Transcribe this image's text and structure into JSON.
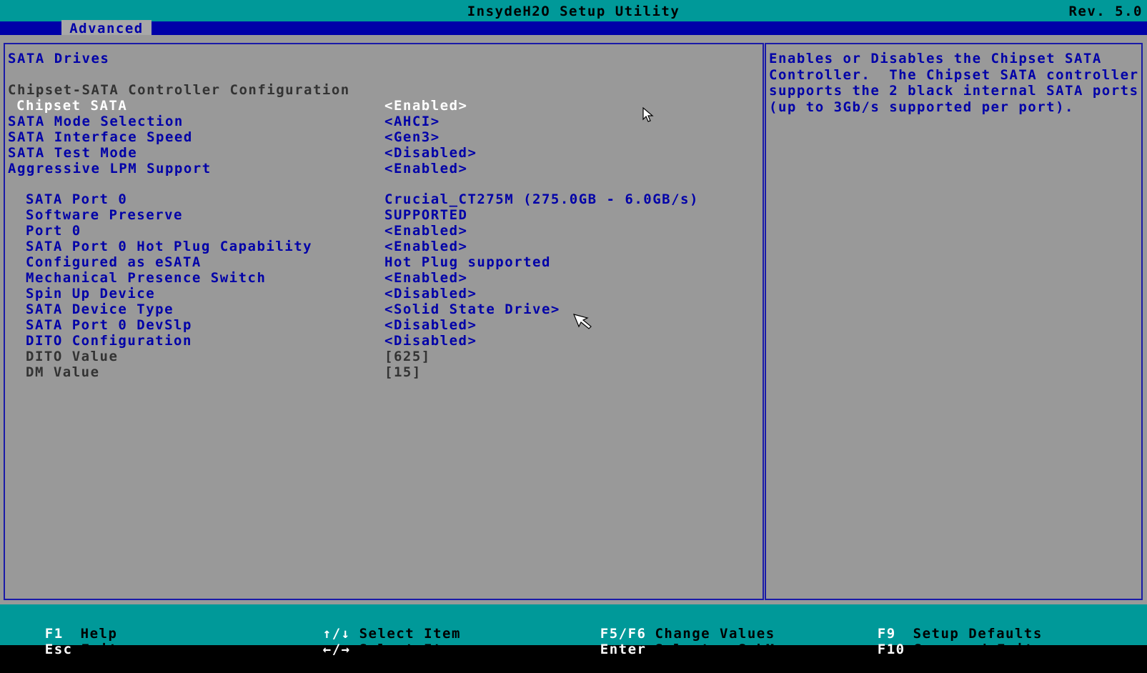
{
  "title": "InsydeH2O Setup Utility",
  "revision": "Rev. 5.0",
  "active_tab": "Advanced",
  "section_title": "SATA Drives",
  "subsection_title": "Chipset-SATA Controller Configuration",
  "settings": [
    {
      "label": "Chipset SATA",
      "value": "<Enabled>"
    },
    {
      "label": "SATA Mode Selection",
      "value": "<AHCI>"
    },
    {
      "label": "SATA Interface Speed",
      "value": "<Gen3>"
    },
    {
      "label": "SATA Test Mode",
      "value": "<Disabled>"
    },
    {
      "label": "Aggressive LPM Support",
      "value": "<Enabled>"
    }
  ],
  "port_settings": [
    {
      "label": "SATA Port 0",
      "value": "Crucial_CT275M (275.0GB - 6.0GB/s)"
    },
    {
      "label": "Software Preserve",
      "value": "SUPPORTED"
    },
    {
      "label": "Port 0",
      "value": "<Enabled>"
    },
    {
      "label": "SATA Port 0 Hot Plug Capability",
      "value": "<Enabled>"
    },
    {
      "label": "Configured as eSATA",
      "value": "Hot Plug supported"
    },
    {
      "label": "Mechanical Presence Switch",
      "value": "<Enabled>"
    },
    {
      "label": "Spin Up Device",
      "value": "<Disabled>"
    },
    {
      "label": "SATA Device Type",
      "value": "<Solid State Drive>"
    },
    {
      "label": "SATA Port 0 DevSlp",
      "value": "<Disabled>"
    },
    {
      "label": "DITO Configuration",
      "value": "<Disabled>"
    },
    {
      "label": "DITO Value",
      "value": "[625]"
    },
    {
      "label": "DM Value",
      "value": "[15]"
    }
  ],
  "help_text": "Enables or Disables the Chipset SATA\nController.  The Chipset SATA controller\nsupports the 2 black internal SATA ports\n(up to 3Gb/s supported per port).",
  "status": {
    "f1_key": "F1",
    "f1_label": "Help",
    "esc_key": "Esc",
    "esc_label": "Exit",
    "updown_key": "↑/↓",
    "updown_label": "Select Item",
    "leftright_key": "←/→",
    "leftright_label": "Select Item",
    "f5f6_key": "F5/F6",
    "f5f6_label": "Change Values",
    "enter_key": "Enter",
    "enter_label": "Select ▶ SubMenu",
    "f9_key": "F9",
    "f9_label": "Setup Defaults",
    "f10_key": "F10",
    "f10_label": "Save and Exit"
  },
  "colors": {
    "title_bg": "#009999",
    "menu_bg": "#0000a8",
    "main_bg": "#999999",
    "text_blue": "#0000a8",
    "selected_text": "#ffffff"
  }
}
